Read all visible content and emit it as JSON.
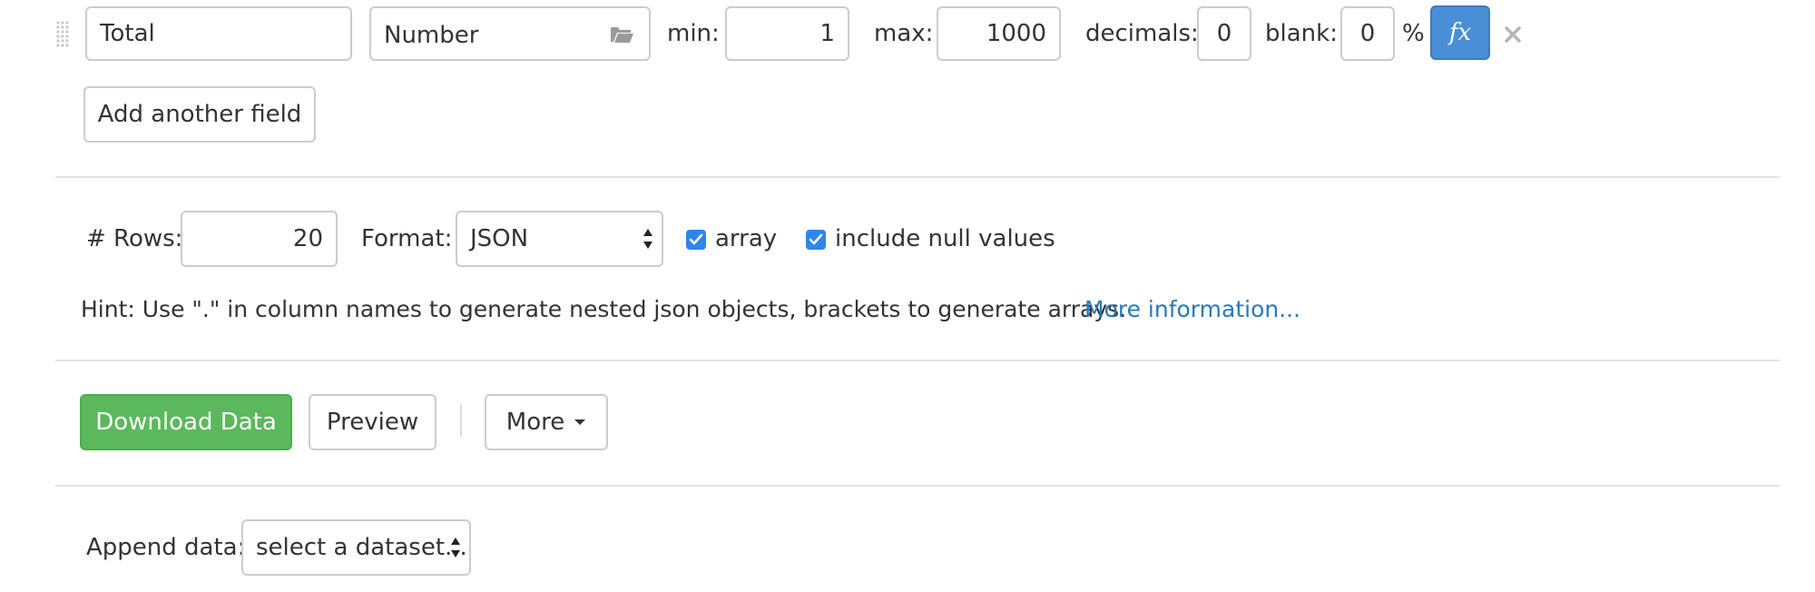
{
  "field_row": {
    "field_name": "Total",
    "type": "Number",
    "min_label": "min:",
    "min_value": "1",
    "max_label": "max:",
    "max_value": "1000",
    "decimals_label": "decimals:",
    "decimals_value": "0",
    "blank_label": "blank:",
    "blank_value": "0",
    "percent": "%",
    "formula_icon": "fx-icon",
    "remove_icon": "close-icon"
  },
  "add_field_label": "Add another field",
  "options": {
    "rows_label": "# Rows:",
    "rows_value": "20",
    "format_label": "Format:",
    "format_value": "JSON",
    "array_label": "array",
    "array_checked": true,
    "include_null_label": "include null values",
    "include_null_checked": true
  },
  "hint": {
    "text": "Hint: Use \".\" in column names to generate nested json objects, brackets to generate arrays.",
    "link": "More information..."
  },
  "actions": {
    "download_label": "Download Data",
    "preview_label": "Preview",
    "more_label": "More"
  },
  "append": {
    "label": "Append data:",
    "select_value": "select a dataset..."
  },
  "colors": {
    "primary_green": "#5cb85c",
    "formula_blue": "#4a8fd6",
    "checkbox_blue": "#2f86e8",
    "link_blue": "#2a7ab8"
  }
}
